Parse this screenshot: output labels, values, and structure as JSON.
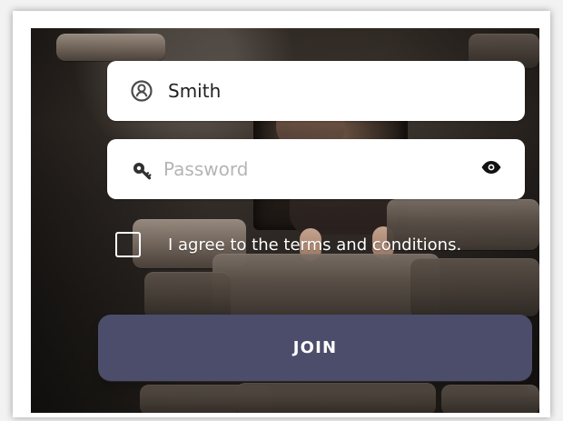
{
  "form": {
    "username_value": "Smith",
    "password_placeholder": "Password",
    "terms_text": "I agree to the terms and conditions.",
    "join_label": "JOIN"
  },
  "icons": {
    "username": "user-icon",
    "password": "key-icon",
    "visibility": "eye-icon"
  },
  "colors": {
    "button": "#4b4d6b",
    "field": "#ffffff"
  }
}
